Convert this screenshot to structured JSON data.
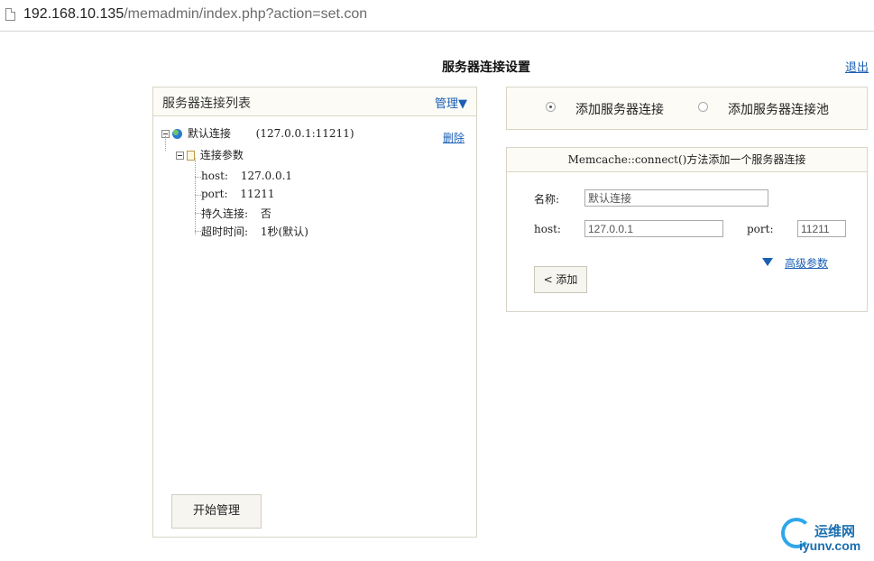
{
  "browser": {
    "url_host": "192.168.10.135",
    "url_rest": "/memadmin/index.php?action=set.con"
  },
  "header": {
    "title": "服务器连接设置",
    "logout": "退出"
  },
  "left_panel": {
    "title": "服务器连接列表",
    "manage": "管理▼",
    "connection_name": "默认连接",
    "connection_address": "(127.0.0.1:11211)",
    "delete": "删除",
    "params_label": "连接参数",
    "params": [
      {
        "key": "host:",
        "value": "127.0.0.1"
      },
      {
        "key": "port:",
        "value": "11211"
      },
      {
        "key": "持久连接:",
        "value": "否"
      },
      {
        "key": "超时时间:",
        "value": "1秒(默认)"
      }
    ],
    "start_button": "开始管理"
  },
  "mode": {
    "options": [
      {
        "label": "添加服务器连接",
        "selected": true
      },
      {
        "label": "添加服务器连接池",
        "selected": false
      }
    ]
  },
  "form": {
    "heading": "Memcache::connect()方法添加一个服务器连接",
    "name_label": "名称:",
    "name_value": "默认连接",
    "host_label": "host:",
    "host_value": "127.0.0.1",
    "port_label": "port:",
    "port_value": "11211",
    "advanced": "高级参数",
    "add_button": "< 添加"
  },
  "watermark": {
    "cn": "运维网",
    "en": "iyunv.com"
  },
  "colors": {
    "link": "#1a5fb4",
    "panel_border": "#d8d5c6",
    "panel_head": "#fcfbf5"
  }
}
